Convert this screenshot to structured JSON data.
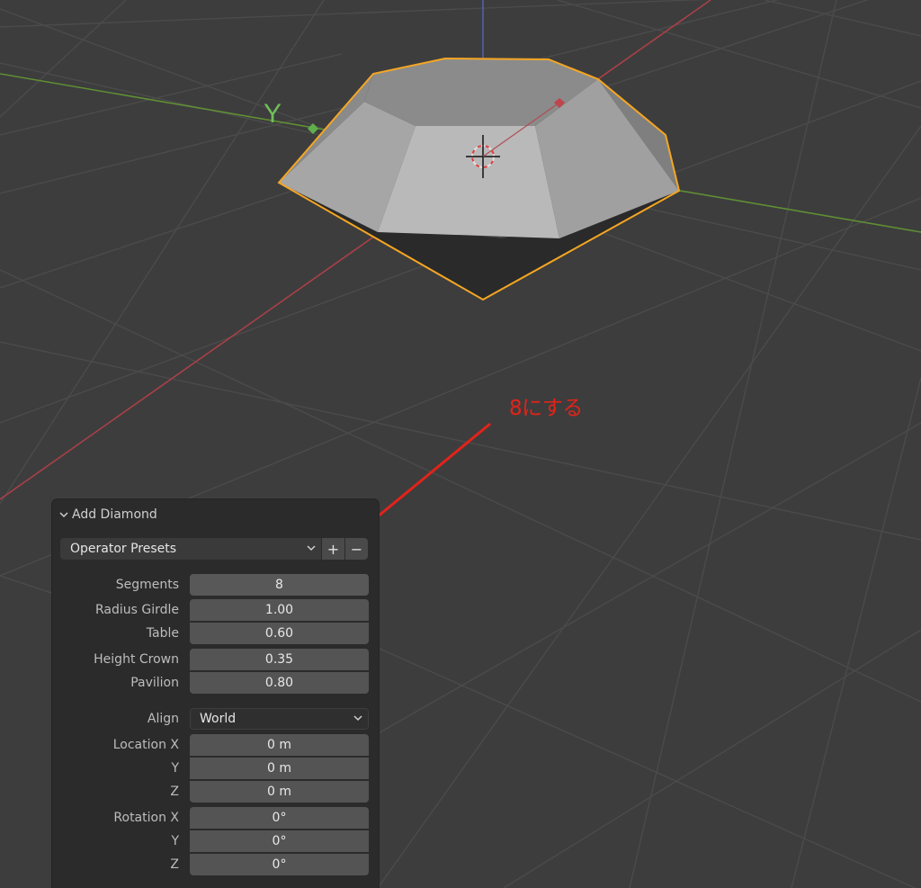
{
  "viewport": {
    "axis_y_label": "Y",
    "colors": {
      "background": "#3d3d3d",
      "grid": "#4a4a4a",
      "x_axis": "#b5434a",
      "y_axis": "#6a9a3a",
      "z_axis": "#5a63b8",
      "selection_outline": "#f5a623"
    }
  },
  "annotation": {
    "text": "8にする",
    "color": "#e2231a"
  },
  "panel": {
    "title": "Add Diamond",
    "presets": {
      "label": "Operator Presets",
      "add_symbol": "+",
      "remove_symbol": "−"
    },
    "fields": [
      {
        "label": "Segments",
        "value": "8"
      },
      {
        "label": "Radius Girdle",
        "value": "1.00"
      },
      {
        "label": "Table",
        "value": "0.60"
      },
      {
        "label": "Height Crown",
        "value": "0.35"
      },
      {
        "label": "Pavilion",
        "value": "0.80"
      }
    ],
    "align": {
      "label": "Align",
      "value": "World"
    },
    "location": [
      {
        "label": "Location X",
        "value": "0 m"
      },
      {
        "label": "Y",
        "value": "0 m"
      },
      {
        "label": "Z",
        "value": "0 m"
      }
    ],
    "rotation": [
      {
        "label": "Rotation X",
        "value": "0°"
      },
      {
        "label": "Y",
        "value": "0°"
      },
      {
        "label": "Z",
        "value": "0°"
      }
    ]
  }
}
